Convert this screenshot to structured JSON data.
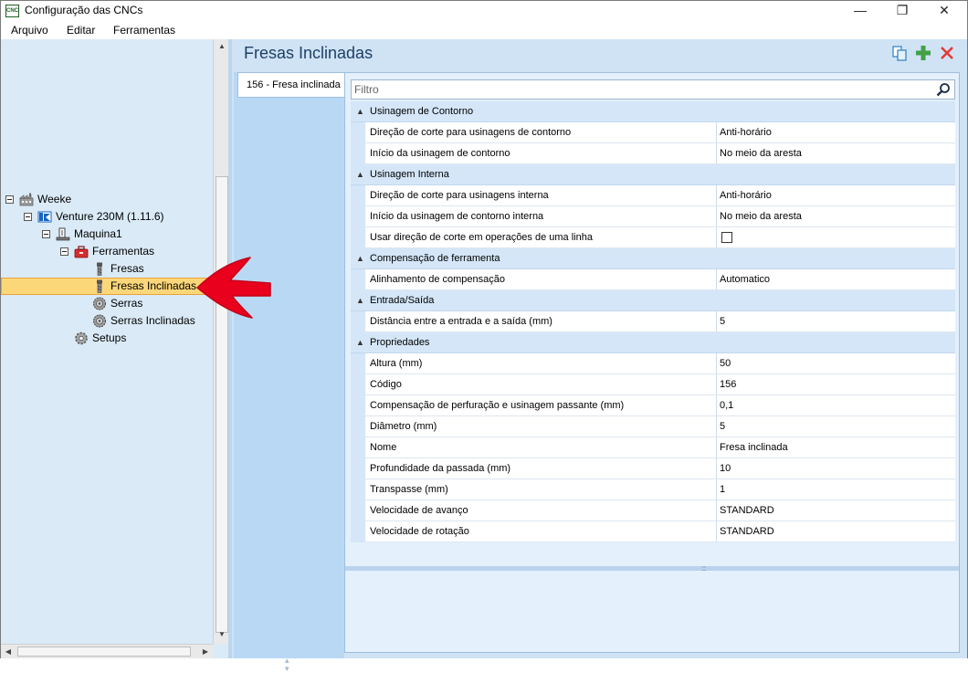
{
  "window": {
    "icon_text": "CNC",
    "title": "Configuração das CNCs",
    "controls": {
      "minimize": "—",
      "maximize": "❐",
      "close": "✕"
    }
  },
  "menu": [
    "Arquivo",
    "Editar",
    "Ferramentas"
  ],
  "tree": {
    "nodes": [
      {
        "label": "Weeke",
        "icon": "factory-icon",
        "expanded": true
      },
      {
        "label": "Venture 230M (1.11.6)",
        "icon": "machine-type-icon",
        "expanded": true
      },
      {
        "label": "Maquina1",
        "icon": "machine-icon",
        "expanded": true
      },
      {
        "label": "Ferramentas",
        "icon": "toolbox-icon",
        "expanded": true
      },
      {
        "label": "Fresas",
        "icon": "router-bit-icon"
      },
      {
        "label": "Fresas Inclinadas",
        "icon": "router-bit-icon",
        "selected": true
      },
      {
        "label": "Serras",
        "icon": "saw-blade-icon"
      },
      {
        "label": "Serras Inclinadas",
        "icon": "saw-blade-icon"
      },
      {
        "label": "Setups",
        "icon": "gear-icon"
      }
    ]
  },
  "panel": {
    "title": "Fresas Inclinadas",
    "toolbar": {
      "copy": "copy-icon",
      "add": "add-icon",
      "delete": "delete-icon"
    },
    "tab": "156 - Fresa inclinada",
    "filter_placeholder": "Filtro"
  },
  "grid": {
    "categories": [
      {
        "label": "Usinagem de Contorno",
        "rows": [
          {
            "name": "Direção de corte para usinagens de contorno",
            "value": "Anti-horário"
          },
          {
            "name": "Início da usinagem de contorno",
            "value": "No meio da aresta"
          }
        ]
      },
      {
        "label": "Usinagem Interna",
        "rows": [
          {
            "name": "Direção de corte para usinagens interna",
            "value": "Anti-horário"
          },
          {
            "name": "Início da usinagem de contorno interna",
            "value": "No meio da aresta"
          },
          {
            "name": "Usar direção de corte em operações de uma linha",
            "value": "",
            "checkbox": true,
            "checked": false
          }
        ]
      },
      {
        "label": "Compensação de ferramenta",
        "rows": [
          {
            "name": "Alinhamento de compensação",
            "value": "Automatico"
          }
        ]
      },
      {
        "label": "Entrada/Saída",
        "rows": [
          {
            "name": "Distância entre a entrada e a saída (mm)",
            "value": "5"
          }
        ]
      },
      {
        "label": "Propriedades",
        "rows": [
          {
            "name": "Altura (mm)",
            "value": "50"
          },
          {
            "name": "Código",
            "value": "156"
          },
          {
            "name": "Compensação de perfuração e usinagem passante (mm)",
            "value": "0,1"
          },
          {
            "name": "Diâmetro (mm)",
            "value": "5"
          },
          {
            "name": "Nome",
            "value": "Fresa inclinada"
          },
          {
            "name": "Profundidade da passada (mm)",
            "value": "10"
          },
          {
            "name": "Transpasse (mm)",
            "value": "1"
          },
          {
            "name": "Velocidade de avanço",
            "value": "STANDARD"
          },
          {
            "name": "Velocidade de rotação",
            "value": "STANDARD"
          }
        ]
      }
    ]
  },
  "colors": {
    "selection_bg": "#fcd77a",
    "panel_bg": "#cfe3f5",
    "title_text": "#1e3f66",
    "arrow": "#e8001c"
  }
}
